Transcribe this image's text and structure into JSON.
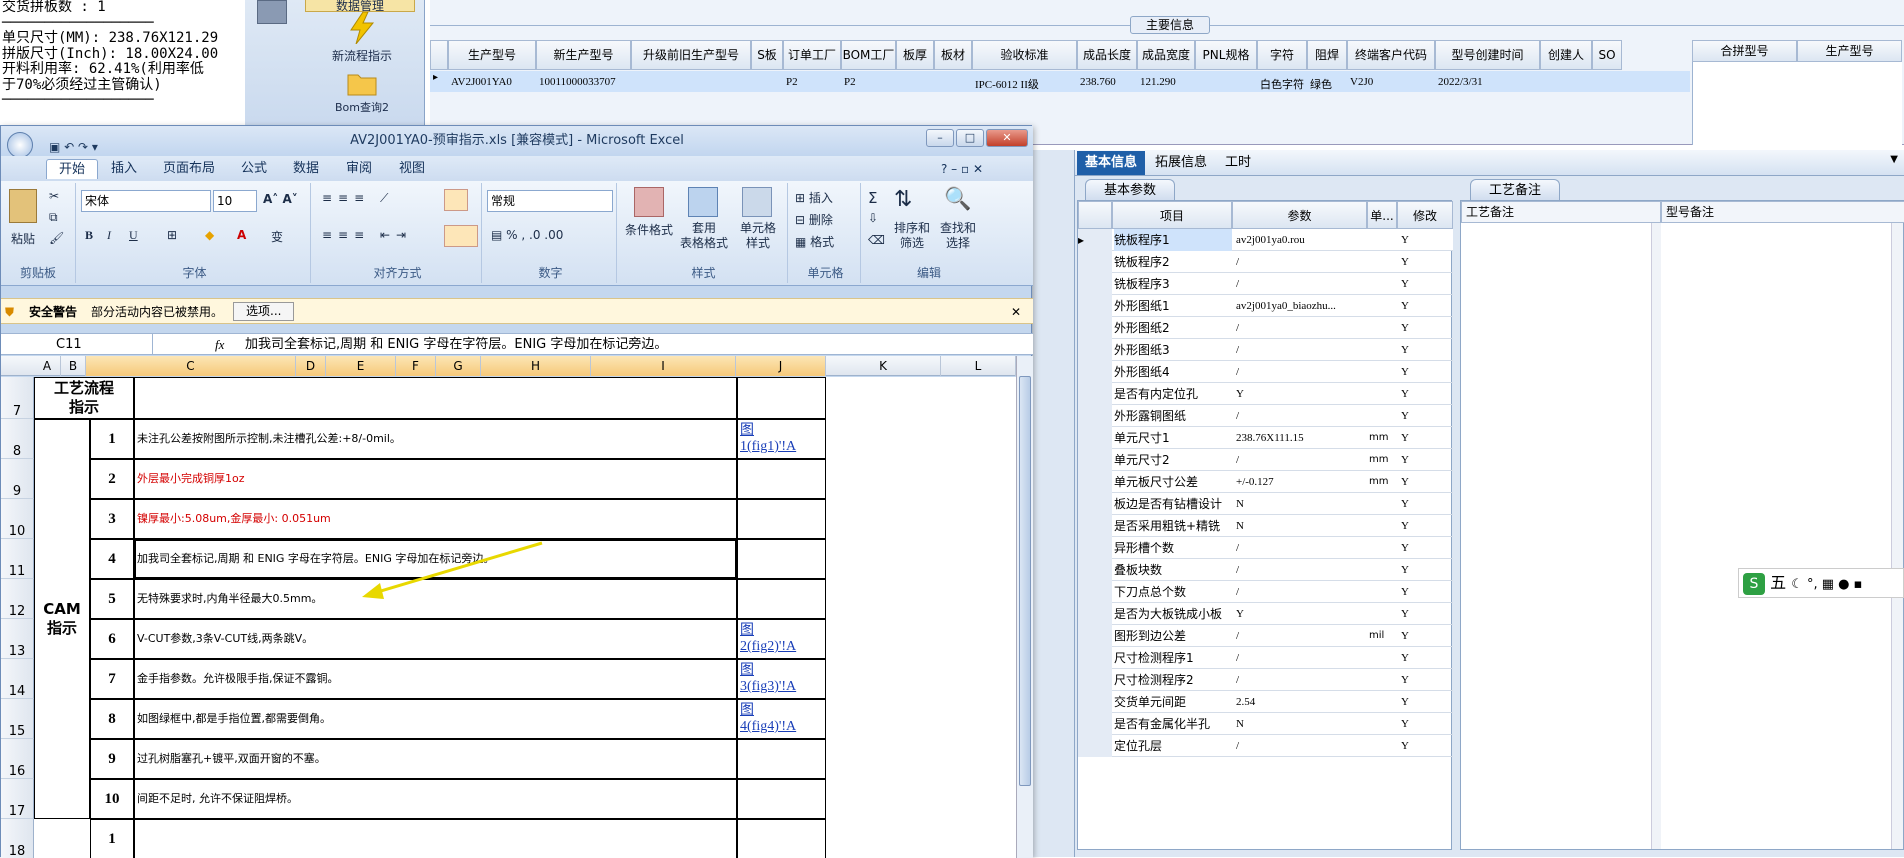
{
  "left_text": {
    "lines": [
      "交货拼板数 : 1",
      "──────────────────",
      "",
      "单只尺寸(MM): 238.76X121.29",
      "拼版尺寸(Inch): 18.00X24.00",
      "开料利用率: 62.41%(利用率低",
      "于70%必须经过主管确认)",
      "──────────────────"
    ]
  },
  "left_toolbar": {
    "items": [
      {
        "label": "数据管理"
      },
      {
        "label": "新流程指示"
      },
      {
        "label": "Bom查询2"
      }
    ]
  },
  "top_grid": {
    "section_title": "主要信息",
    "headers": [
      "生产型号",
      "新生产型号",
      "升级前旧生产型号",
      "S板",
      "订单工厂",
      "BOM工厂",
      "板厚",
      "板材",
      "验收标准",
      "成品长度",
      "成品宽度",
      "PNL规格",
      "字符",
      "阻焊",
      "终端客户代码",
      "型号创建时间",
      "创建人",
      "SO"
    ],
    "row": [
      "AV2J001YA0",
      "10011000033707",
      "",
      "",
      "P2",
      "P2",
      "",
      "",
      "IPC-6012 II级",
      "238.760",
      "121.290",
      "",
      "白色字符",
      "绿色",
      "V2J0",
      "2022/3/31",
      "",
      ""
    ],
    "right_headers": [
      "合拼型号",
      "生产型号"
    ]
  },
  "right_tabs": [
    "基本信息",
    "拓展信息",
    "工时"
  ],
  "params": {
    "tab_label": "基本参数",
    "headers": [
      "项目",
      "参数",
      "单...",
      "修改"
    ],
    "rows": [
      [
        "铣板程序1",
        "av2j001ya0.rou",
        "",
        "Y"
      ],
      [
        "铣板程序2",
        "/",
        "",
        "Y"
      ],
      [
        "铣板程序3",
        "/",
        "",
        "Y"
      ],
      [
        "外形图纸1",
        "av2j001ya0_biaozhu...",
        "",
        "Y"
      ],
      [
        "外形图纸2",
        "/",
        "",
        "Y"
      ],
      [
        "外形图纸3",
        "/",
        "",
        "Y"
      ],
      [
        "外形图纸4",
        "/",
        "",
        "Y"
      ],
      [
        "是否有内定位孔",
        "Y",
        "",
        "Y"
      ],
      [
        "外形露铜图纸",
        "/",
        "",
        "Y"
      ],
      [
        "单元尺寸1",
        "238.76X111.15",
        "mm",
        "Y"
      ],
      [
        "单元尺寸2",
        "/",
        "mm",
        "Y"
      ],
      [
        "单元板尺寸公差",
        "+/-0.127",
        "mm",
        "Y"
      ],
      [
        "板边是否有钻槽设计",
        "N",
        "",
        "Y"
      ],
      [
        "是否采用粗铣+精铣",
        "N",
        "",
        "Y"
      ],
      [
        "异形槽个数",
        "/",
        "",
        "Y"
      ],
      [
        "叠板块数",
        "/",
        "",
        "Y"
      ],
      [
        "下刀点总个数",
        "/",
        "",
        "Y"
      ],
      [
        "是否为大板铣成小板",
        "Y",
        "",
        "Y"
      ],
      [
        "图形到边公差",
        "/",
        "mil",
        "Y"
      ],
      [
        "尺寸检测程序1",
        "/",
        "",
        "Y"
      ],
      [
        "尺寸检测程序2",
        "/",
        "",
        "Y"
      ],
      [
        "交货单元间距",
        "2.54",
        "",
        "Y"
      ],
      [
        "是否有金属化半孔",
        "N",
        "",
        "Y"
      ],
      [
        "定位孔层",
        "/",
        "",
        "Y"
      ]
    ]
  },
  "notes": {
    "tab_label": "工艺备注",
    "col1": "工艺备注",
    "col2": "型号备注"
  },
  "excel": {
    "title": "AV2J001YA0-预审指示.xls  [兼容模式] - Microsoft Excel",
    "menu": [
      "开始",
      "插入",
      "页面布局",
      "公式",
      "数据",
      "审阅",
      "视图"
    ],
    "font_name": "宋体",
    "font_size": "10",
    "number_format": "常规",
    "ribbon_groups": [
      "剪贴板",
      "字体",
      "对齐方式",
      "数字",
      "样式",
      "单元格",
      "编辑"
    ],
    "ribbon_buttons": {
      "paste": "粘贴",
      "cond_format": "条件格式",
      "table_format": "套用\n表格格式",
      "cell_style": "单元格\n样式",
      "insert": "插入",
      "delete": "删除",
      "format": "格式",
      "sort": "排序和\n筛选",
      "find": "查找和\n选择"
    },
    "security": {
      "label": "安全警告",
      "msg": "部分活动内容已被禁用。",
      "btn": "选项..."
    },
    "namebox": "C11",
    "fx": "fx",
    "formula": "加我司全套标记,周期 和 ENIG 字母在字符层。ENIG 字母加在标记旁边。",
    "columns": [
      "A",
      "B",
      "C",
      "D",
      "E",
      "F",
      "G",
      "H",
      "I",
      "J",
      "K",
      "L"
    ],
    "header_cell": "工艺流程\n指示",
    "cam_label": "CAM\n指示",
    "rows": [
      {
        "rn": "8",
        "n": "1",
        "text": "未注孔公差按附图所示控制,未注槽孔公差:+8/-0mil。",
        "link": "图\n1(fig1)'!A",
        "red": false
      },
      {
        "rn": "9",
        "n": "2",
        "text": "外层最小完成铜厚1oz",
        "link": "",
        "red": true
      },
      {
        "rn": "10",
        "n": "3",
        "text": "镍厚最小:5.08um,金厚最小: 0.051um",
        "link": "",
        "red": true
      },
      {
        "rn": "11",
        "n": "4",
        "text": "加我司全套标记,周期 和 ENIG 字母在字符层。ENIG 字母加在标记旁边。",
        "link": "",
        "red": false
      },
      {
        "rn": "12",
        "n": "5",
        "text": "无特殊要求时,内角半径最大0.5mm。",
        "link": "",
        "red": false
      },
      {
        "rn": "13",
        "n": "6",
        "text": "V-CUT参数,3条V-CUT线,两条跳V。",
        "link": "图\n2(fig2)'!A",
        "red": false
      },
      {
        "rn": "14",
        "n": "7",
        "text": "金手指参数。允许极限手指,保证不露铜。",
        "link": "图\n3(fig3)'!A",
        "red": false
      },
      {
        "rn": "15",
        "n": "8",
        "text": "如图绿框中,都是手指位置,都需要倒角。",
        "link": "图\n4(fig4)'!A",
        "red": false
      },
      {
        "rn": "16",
        "n": "9",
        "text": "过孔树脂塞孔+镀平,双面开窗的不塞。",
        "link": "",
        "red": false
      },
      {
        "rn": "17",
        "n": "10",
        "text": "间距不足时, 允许不保证阻焊桥。",
        "link": "",
        "red": false
      },
      {
        "rn": "18",
        "n": "1",
        "text": "",
        "link": "",
        "red": false
      }
    ],
    "row7": "7"
  },
  "ime": "五",
  "colors": {
    "accent": "#1f5fa8",
    "selected_row": "#cfe3fb",
    "red_text": "#d40000",
    "link": "#1a3fb8"
  }
}
